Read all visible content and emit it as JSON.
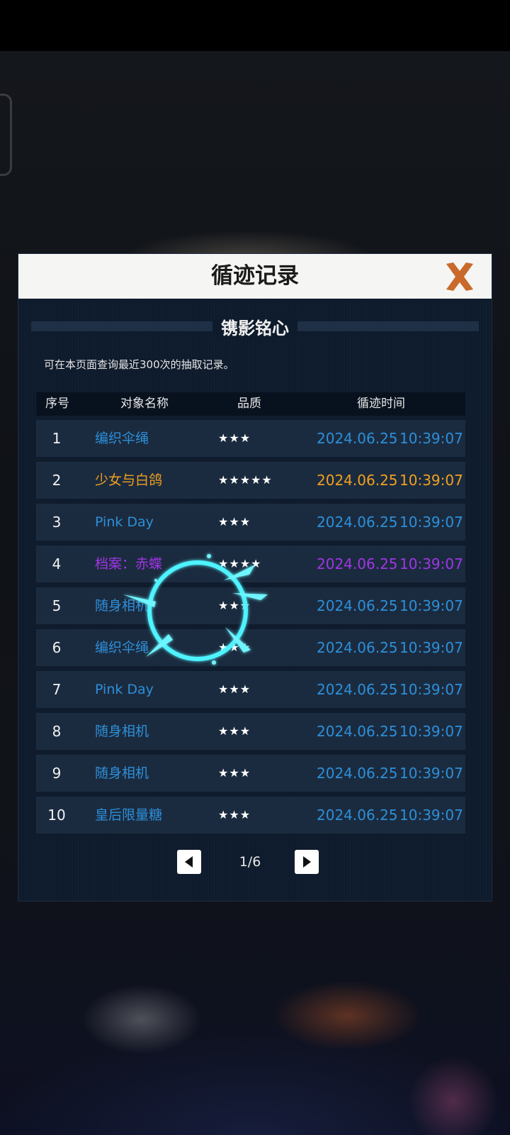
{
  "modal": {
    "title": "循迹记录",
    "section_title": "镌影铭心",
    "notice": "可在本页面查询最近300次的抽取记录。"
  },
  "table": {
    "headers": [
      "序号",
      "对象名称",
      "品质",
      "循迹时间"
    ],
    "rows": [
      {
        "index": "1",
        "name": "编织伞绳",
        "stars": "★★★",
        "date": "2024.06.25",
        "time": "10:39:07",
        "color": "#2d8fd9"
      },
      {
        "index": "2",
        "name": "少女与白鸽",
        "stars": "★★★★★",
        "date": "2024.06.25",
        "time": "10:39:07",
        "color": "#f0a020"
      },
      {
        "index": "3",
        "name": "Pink Day",
        "stars": "★★★",
        "date": "2024.06.25",
        "time": "10:39:07",
        "color": "#2d8fd9"
      },
      {
        "index": "4",
        "name": "档案：赤蝶",
        "stars": "★★★★",
        "date": "2024.06.25",
        "time": "10:39:07",
        "color": "#a035e6"
      },
      {
        "index": "5",
        "name": "随身相机",
        "stars": "★★★",
        "date": "2024.06.25",
        "time": "10:39:07",
        "color": "#2d8fd9"
      },
      {
        "index": "6",
        "name": "编织伞绳",
        "stars": "★★★",
        "date": "2024.06.25",
        "time": "10:39:07",
        "color": "#2d8fd9"
      },
      {
        "index": "7",
        "name": "Pink Day",
        "stars": "★★★",
        "date": "2024.06.25",
        "time": "10:39:07",
        "color": "#2d8fd9"
      },
      {
        "index": "8",
        "name": "随身相机",
        "stars": "★★★",
        "date": "2024.06.25",
        "time": "10:39:07",
        "color": "#2d8fd9"
      },
      {
        "index": "9",
        "name": "随身相机",
        "stars": "★★★",
        "date": "2024.06.25",
        "time": "10:39:07",
        "color": "#2d8fd9"
      },
      {
        "index": "10",
        "name": "皇后限量糖",
        "stars": "★★★",
        "date": "2024.06.25",
        "time": "10:39:07",
        "color": "#2d8fd9"
      }
    ]
  },
  "pager": {
    "label": "1/6",
    "prev_icon": "triangle-left-icon",
    "next_icon": "triangle-right-icon"
  },
  "icons": {
    "close": "close-x-icon",
    "touch_effect": "touch-ripple-icon"
  },
  "colors": {
    "three_star": "#2d8fd9",
    "five_star": "#f0a020",
    "four_star": "#a035e6",
    "close": "#c96a2c"
  }
}
